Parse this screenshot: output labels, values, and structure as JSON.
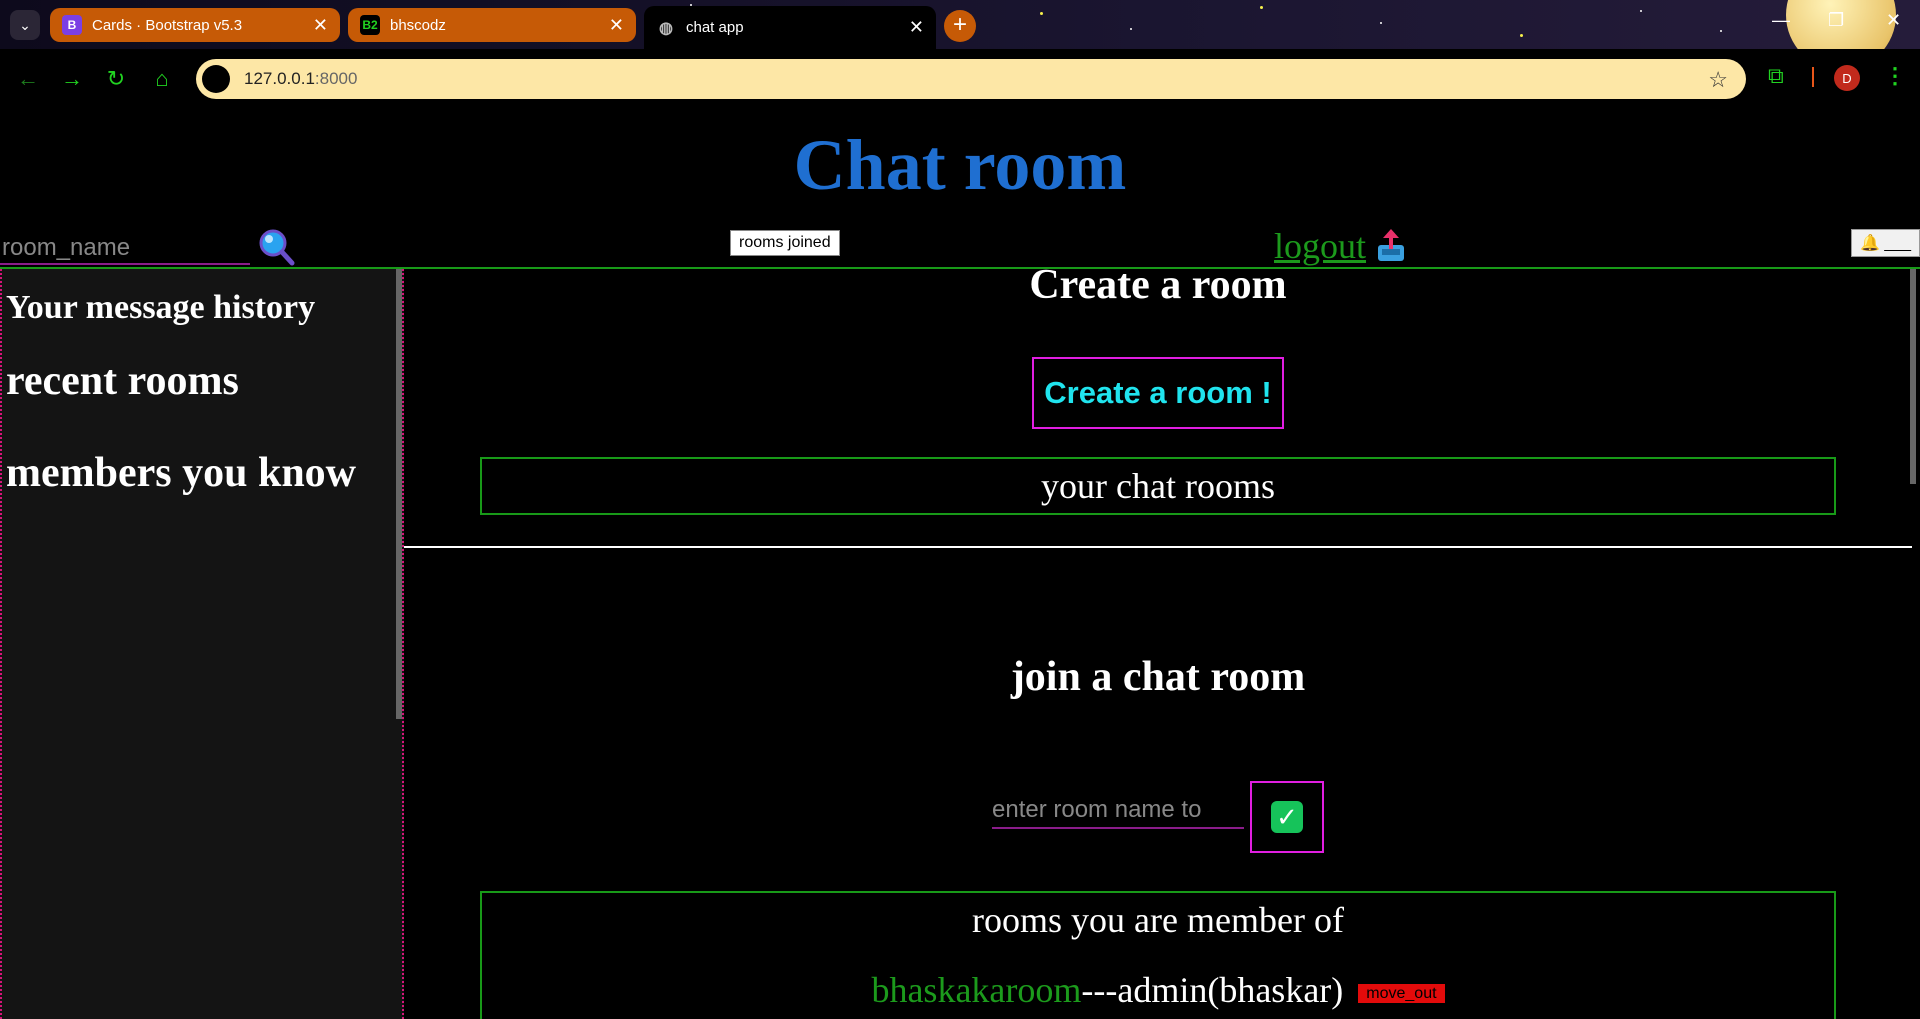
{
  "browser": {
    "tabs": [
      {
        "title": "Cards · Bootstrap v5.3",
        "favicon": "B"
      },
      {
        "title": "bhscodz",
        "favicon": "B2"
      },
      {
        "title": "chat app",
        "favicon": "globe-icon"
      }
    ],
    "url_host": "127.0.0.1",
    "url_port": ":8000",
    "profile_initial": "D"
  },
  "header": {
    "title": "Chat room",
    "search_placeholder": "room_name",
    "rooms_joined_label": "rooms joined",
    "logout_label": "logout",
    "notification_label": "🔔 ___"
  },
  "sidebar": {
    "items": [
      {
        "label": "Your message history"
      },
      {
        "label": "recent rooms"
      },
      {
        "label": "members you know"
      }
    ]
  },
  "main": {
    "create_heading": "Create a room",
    "create_button_label": "Create a room !",
    "chat_rooms_label": "your chat rooms",
    "join_heading": "join a chat room",
    "join_placeholder": "enter room name to",
    "member_title": "rooms you are member of",
    "rooms": [
      {
        "name": "bhaskakaroom",
        "admin_text": "---admin(bhaskar)",
        "action_label": "move_out"
      }
    ]
  },
  "colors": {
    "title_blue": "#1f6fd1",
    "link_green": "#1c9a1c",
    "accent_magenta": "#e11ee1",
    "button_cyan": "#20e4ee",
    "danger_red": "#e30b0b"
  }
}
